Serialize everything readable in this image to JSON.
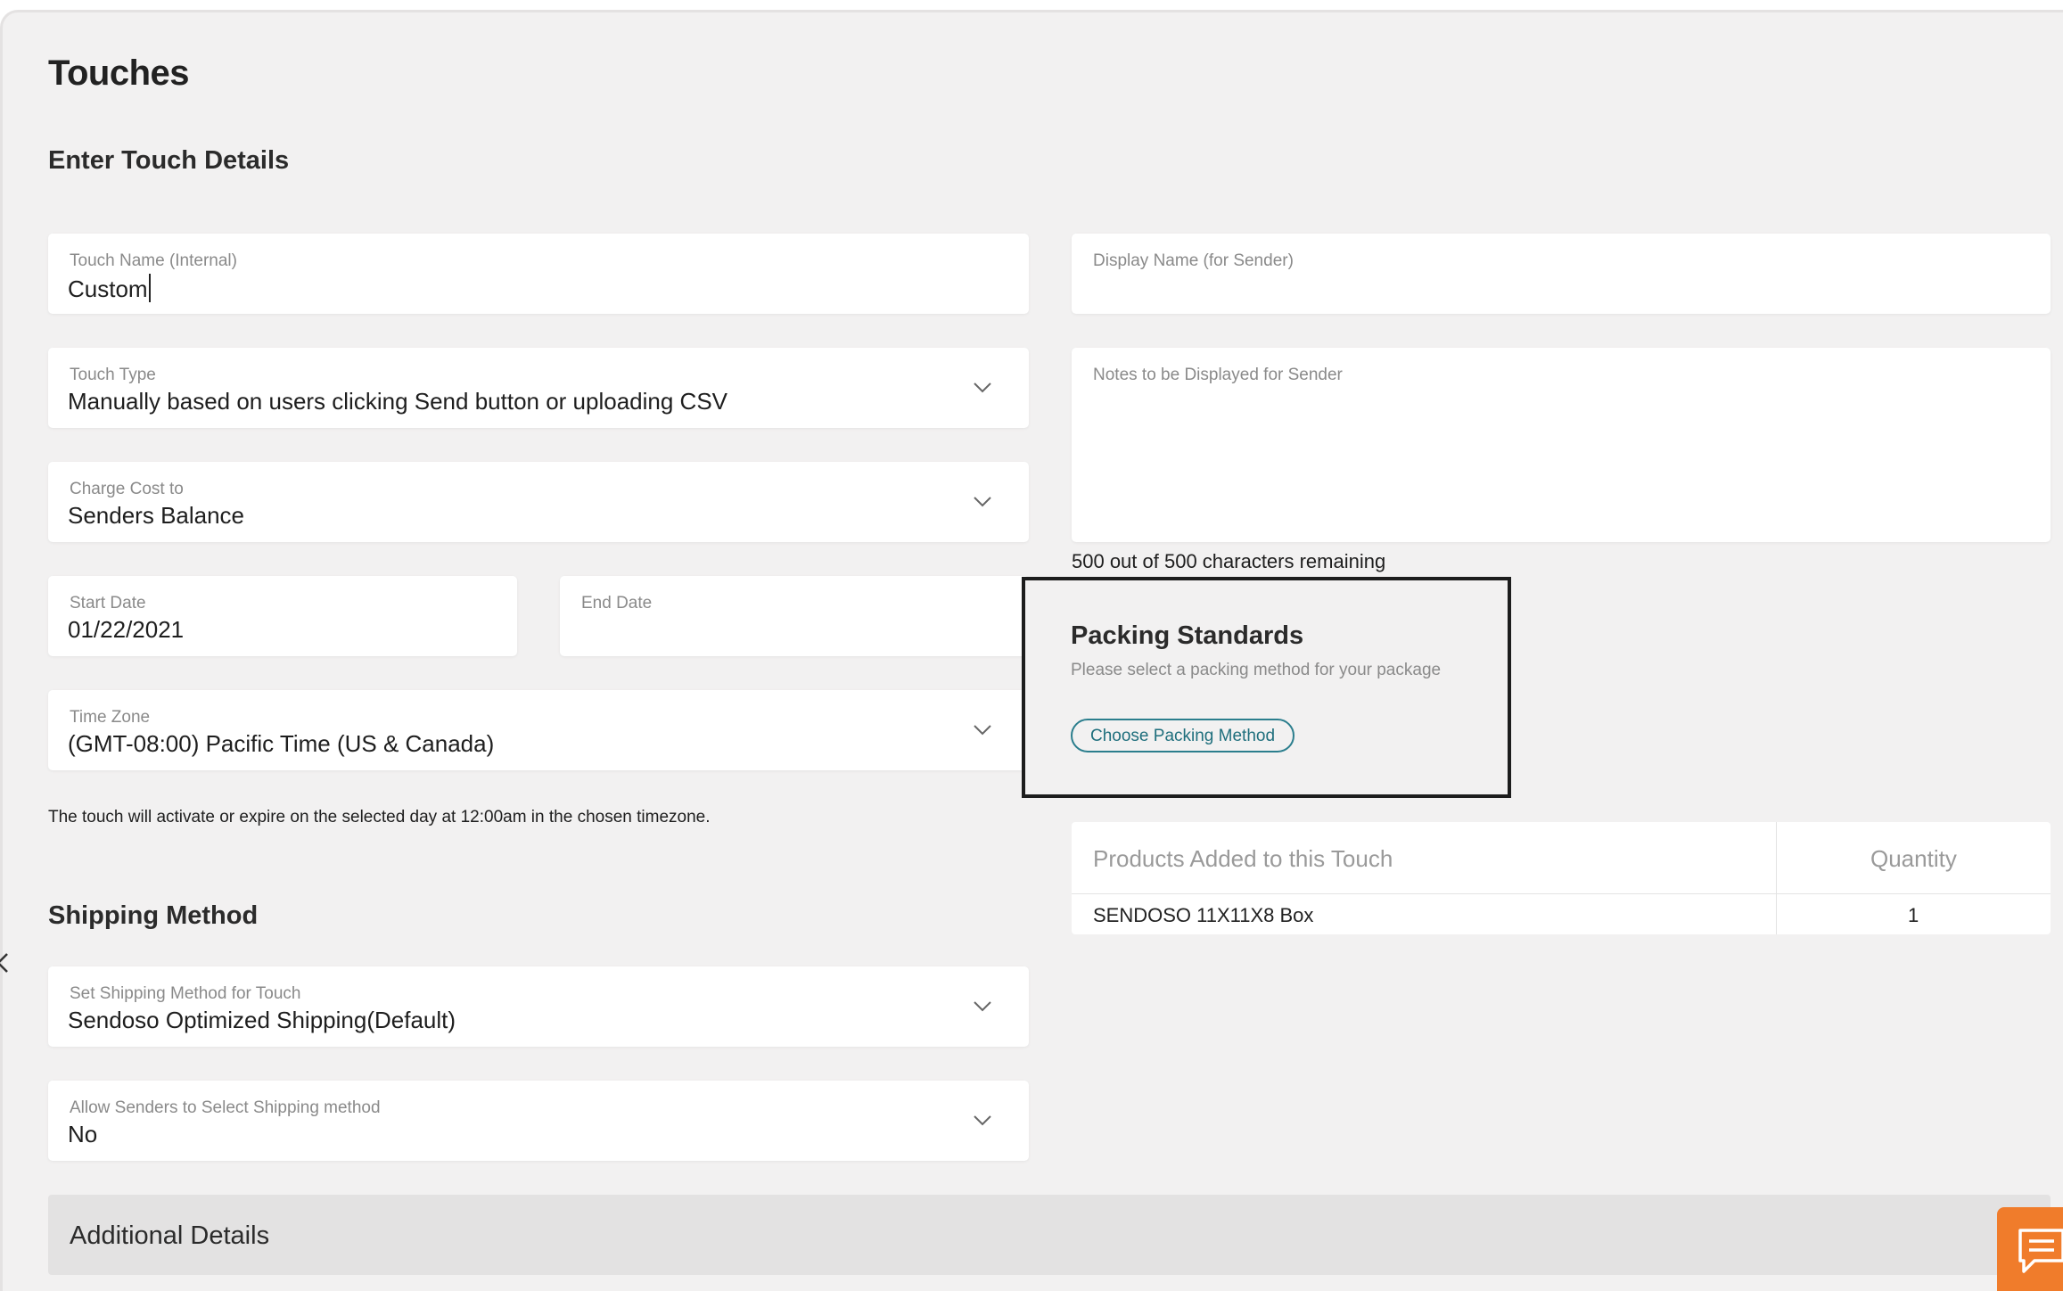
{
  "page": {
    "title": "Touches",
    "section_details": "Enter Touch Details",
    "section_shipping": "Shipping Method"
  },
  "fields": {
    "touch_name": {
      "label": "Touch Name (Internal)",
      "value": "Custom"
    },
    "display_name": {
      "label": "Display Name (for Sender)",
      "value": ""
    },
    "touch_type": {
      "label": "Touch Type",
      "value": "Manually based on users clicking Send button or uploading CSV"
    },
    "notes": {
      "label": "Notes to be Displayed for Sender",
      "value": ""
    },
    "charge_cost": {
      "label": "Charge Cost to",
      "value": "Senders Balance"
    },
    "start_date": {
      "label": "Start Date",
      "value": "01/22/2021"
    },
    "end_date": {
      "label": "End Date",
      "value": ""
    },
    "time_zone": {
      "label": "Time Zone",
      "value": "(GMT-08:00) Pacific Time (US & Canada)"
    },
    "shipping_method": {
      "label": "Set Shipping Method for Touch",
      "value": "Sendoso Optimized Shipping(Default)"
    },
    "allow_select": {
      "label": "Allow Senders to Select Shipping method",
      "value": "No"
    }
  },
  "chars_remaining": "500 out of 500 characters remaining",
  "timezone_note": "The touch will activate or expire on the selected day at 12:00am in the chosen timezone.",
  "packing": {
    "title": "Packing Standards",
    "subtitle": "Please select a packing method for your package",
    "button": "Choose Packing Method"
  },
  "products": {
    "headers": [
      "Products Added to this Touch",
      "Quantity"
    ],
    "rows": [
      {
        "name": "SENDOSO 11X11X8 Box",
        "qty": "1"
      }
    ]
  },
  "additional": {
    "title": "Additional Details"
  },
  "icons": {
    "chevron": "chevron-down-icon",
    "chat": "chat-icon",
    "back": "chevron-left-icon"
  },
  "colors": {
    "accent_teal": "#2b7e8d",
    "chat_orange": "#f07c2b",
    "background": "#f2f1f1"
  }
}
